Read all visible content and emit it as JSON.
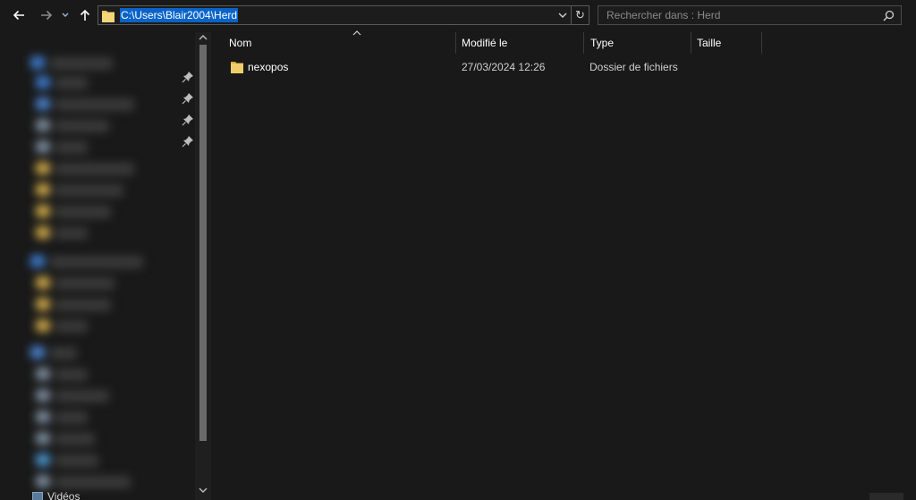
{
  "toolbar": {
    "back_icon": "arrow-left-icon",
    "forward_icon": "arrow-right-icon",
    "recent_icon": "chevron-down-icon",
    "up_icon": "arrow-up-icon"
  },
  "address": {
    "path": "C:\\Users\\Blair2004\\Herd",
    "selection_color": "#0a64c8"
  },
  "refresh": {
    "glyph": "↻",
    "icon": "refresh-icon"
  },
  "search": {
    "placeholder": "Rechercher dans : Herd",
    "icon": "search-icon"
  },
  "sidebar": {
    "bottom_item_label": "Vidéos"
  },
  "columns": {
    "name": "Nom",
    "modified": "Modifié le",
    "type": "Type",
    "size": "Taille"
  },
  "files": [
    {
      "name": "nexopos",
      "modified": "27/03/2024 12:26",
      "type": "Dossier de fichiers",
      "size": ""
    }
  ],
  "colors": {
    "background": "#191919",
    "folder": "#e8c35a",
    "accent": "#0a64c8"
  }
}
